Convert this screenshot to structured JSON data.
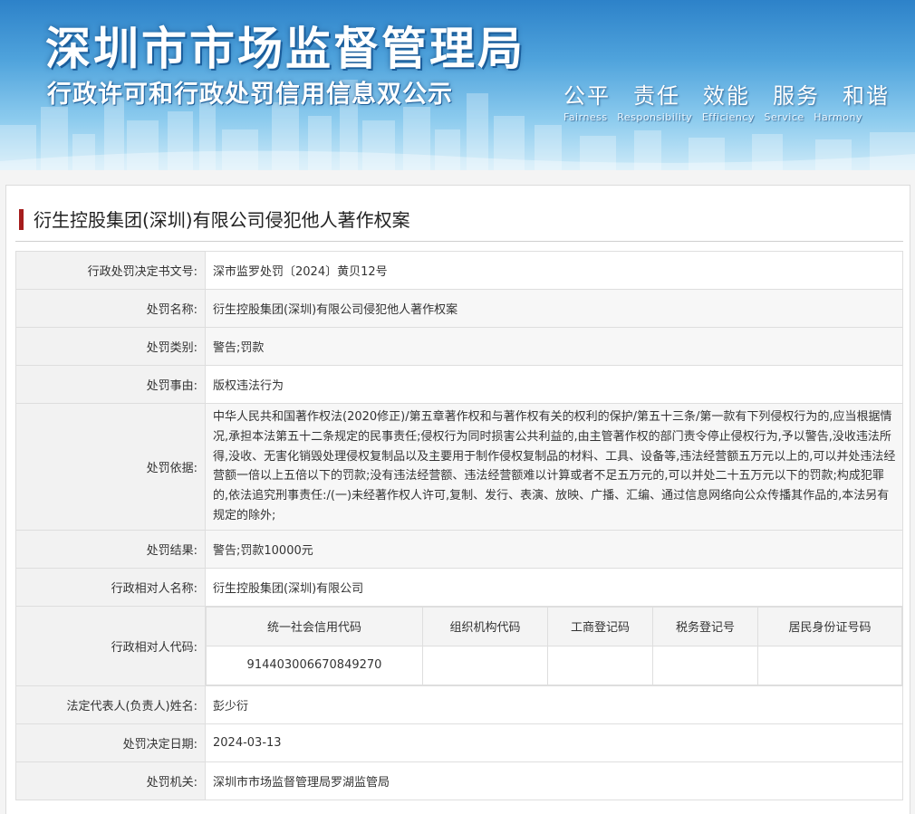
{
  "banner": {
    "title": "深圳市市场监督管理局",
    "subtitle": "行政许可和行政处罚信用信息双公示",
    "slogans_cn": [
      "公平",
      "责任",
      "效能",
      "服务",
      "和谐"
    ],
    "slogans_en": [
      "Fairness",
      "Responsibility",
      "Efficiency",
      "Service",
      "Harmony"
    ]
  },
  "case": {
    "title": "衍生控股集团(深圳)有限公司侵犯他人著作权案"
  },
  "rows": {
    "doc_no": {
      "label": "行政处罚决定书文号:",
      "value": "深市监罗处罚〔2024〕黄贝12号"
    },
    "name": {
      "label": "处罚名称:",
      "value": "衍生控股集团(深圳)有限公司侵犯他人著作权案"
    },
    "category": {
      "label": "处罚类别:",
      "value": "警告;罚款"
    },
    "reason": {
      "label": "处罚事由:",
      "value": "版权违法行为"
    },
    "basis": {
      "label": "处罚依据:",
      "value": "中华人民共和国著作权法(2020修正)/第五章著作权和与著作权有关的权利的保护/第五十三条/第一款有下列侵权行为的,应当根据情况,承担本法第五十二条规定的民事责任;侵权行为同时损害公共利益的,由主管著作权的部门责令停止侵权行为,予以警告,没收违法所得,没收、无害化销毁处理侵权复制品以及主要用于制作侵权复制品的材料、工具、设备等,违法经营额五万元以上的,可以并处违法经营额一倍以上五倍以下的罚款;没有违法经营额、违法经营额难以计算或者不足五万元的,可以并处二十五万元以下的罚款;构成犯罪的,依法追究刑事责任:/(一)未经著作权人许可,复制、发行、表演、放映、广播、汇编、通过信息网络向公众传播其作品的,本法另有规定的除外;"
    },
    "result": {
      "label": "处罚结果:",
      "value": "警告;罚款10000元"
    },
    "party_name": {
      "label": "行政相对人名称:",
      "value": "衍生控股集团(深圳)有限公司"
    },
    "party_code": {
      "label": "行政相对人代码:",
      "headers": [
        "统一社会信用代码",
        "组织机构代码",
        "工商登记码",
        "税务登记号",
        "居民身份证号码"
      ],
      "values": [
        "914403006670849270",
        "",
        "",
        "",
        ""
      ]
    },
    "legal_rep": {
      "label": "法定代表人(负责人)姓名:",
      "value": "彭少衍"
    },
    "decision_date": {
      "label": "处罚决定日期:",
      "value": "2024-03-13"
    },
    "authority": {
      "label": "处罚机关:",
      "value": "深圳市市场监督管理局罗湖监管局"
    }
  }
}
